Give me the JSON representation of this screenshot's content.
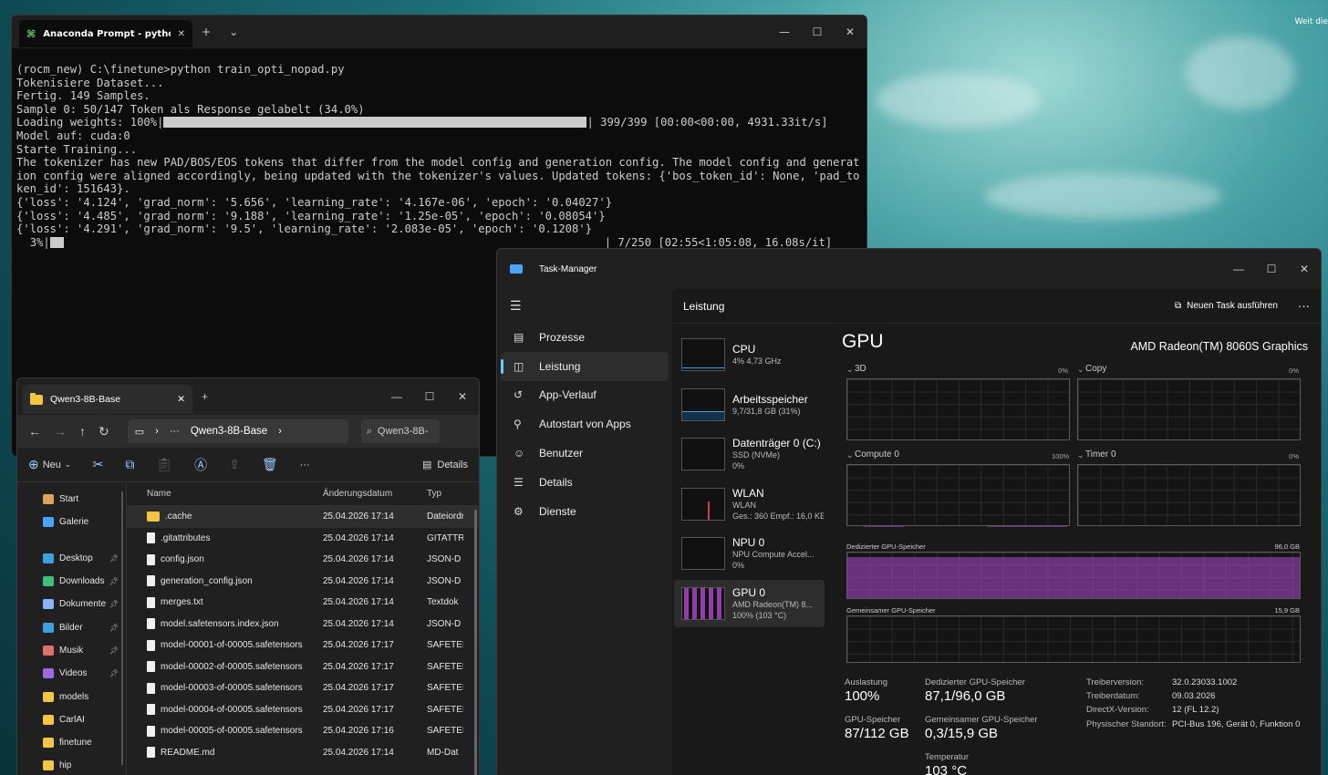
{
  "desktop": {
    "note": "Weit die"
  },
  "terminal": {
    "tab_title": "Anaconda Prompt - python t",
    "lines": {
      "l1": "(rocm_new) C:\\finetune>python train_opti_nopad.py",
      "l2": "Tokenisiere Dataset...",
      "l3": "Fertig. 149 Samples.",
      "l4": "Sample 0: 50/147 Token als Response gelabelt (34.0%)",
      "l5a": "Loading weights: 100%|",
      "l5b": "| 399/399 [00:00<00:00, 4931.33it/s]",
      "l6": "Model auf: cuda:0",
      "l7": "Starte Training...",
      "l8": "The tokenizer has new PAD/BOS/EOS tokens that differ from the model config and generation config. The model config and generation config were aligned accordingly, being updated with the tokenizer's values. Updated tokens: {'bos_token_id': None, 'pad_token_id': 151643}.",
      "l9": "{'loss': '4.124', 'grad_norm': '5.656', 'learning_rate': '4.167e-06', 'epoch': '0.04027'}",
      "l10": "{'loss': '4.485', 'grad_norm': '9.188', 'learning_rate': '1.25e-05', 'epoch': '0.08054'}",
      "l11": "{'loss': '4.291', 'grad_norm': '9.5', 'learning_rate': '2.083e-05', 'epoch': '0.1208'}",
      "l12a": "  3%|",
      "l12b": "| 7/250 [02:55<1:05:08, 16.08s/it]"
    },
    "progress": {
      "weights_fraction": 1.0,
      "training_fraction": 0.03
    }
  },
  "explorer": {
    "tab_title": "Qwen3-8B-Base",
    "path": "Qwen3-8B-Base",
    "search_placeholder": "Qwen3-8B-",
    "new_label": "Neu",
    "details_label": "Details",
    "nav": [
      {
        "label": "Start",
        "color": "#e0a05a",
        "pin": false
      },
      {
        "label": "Galerie",
        "color": "#4aa3ff",
        "pin": false
      },
      {
        "label": "Desktop",
        "color": "#3fa0e0",
        "pin": true
      },
      {
        "label": "Downloads",
        "color": "#3fc07a",
        "pin": true
      },
      {
        "label": "Dokumente",
        "color": "#8ab4f8",
        "pin": true
      },
      {
        "label": "Bilder",
        "color": "#3fa0e0",
        "pin": true
      },
      {
        "label": "Musik",
        "color": "#e0706a",
        "pin": true
      },
      {
        "label": "Videos",
        "color": "#9a6ae0",
        "pin": true
      },
      {
        "label": "models",
        "color": "#f4c542",
        "pin": false
      },
      {
        "label": "CarlAI",
        "color": "#f4c542",
        "pin": false
      },
      {
        "label": "finetune",
        "color": "#f4c542",
        "pin": false
      },
      {
        "label": "hip",
        "color": "#f4c542",
        "pin": false
      }
    ],
    "columns": {
      "name": "Name",
      "date": "Änderungsdatum",
      "type": "Typ"
    },
    "files": [
      {
        "name": ".cache",
        "date": "25.04.2026 17:14",
        "type": "Dateiordner",
        "folder": true
      },
      {
        "name": ".gitattributes",
        "date": "25.04.2026 17:14",
        "type": "GITATTR",
        "folder": false
      },
      {
        "name": "config.json",
        "date": "25.04.2026 17:14",
        "type": "JSON-D",
        "folder": false
      },
      {
        "name": "generation_config.json",
        "date": "25.04.2026 17:14",
        "type": "JSON-D",
        "folder": false
      },
      {
        "name": "merges.txt",
        "date": "25.04.2026 17:14",
        "type": "Textdok",
        "folder": false
      },
      {
        "name": "model.safetensors.index.json",
        "date": "25.04.2026 17:14",
        "type": "JSON-D",
        "folder": false
      },
      {
        "name": "model-00001-of-00005.safetensors",
        "date": "25.04.2026 17:17",
        "type": "SAFETEI",
        "folder": false
      },
      {
        "name": "model-00002-of-00005.safetensors",
        "date": "25.04.2026 17:17",
        "type": "SAFETEI",
        "folder": false
      },
      {
        "name": "model-00003-of-00005.safetensors",
        "date": "25.04.2026 17:17",
        "type": "SAFETEI",
        "folder": false
      },
      {
        "name": "model-00004-of-00005.safetensors",
        "date": "25.04.2026 17:17",
        "type": "SAFETEI",
        "folder": false
      },
      {
        "name": "model-00005-of-00005.safetensors",
        "date": "25.04.2026 17:16",
        "type": "SAFETEI",
        "folder": false
      },
      {
        "name": "README.md",
        "date": "25.04.2026 17:14",
        "type": "MD-Dat",
        "folder": false
      }
    ]
  },
  "taskmanager": {
    "title": "Task-Manager",
    "nav": [
      "Prozesse",
      "Leistung",
      "App-Verlauf",
      "Autostart von Apps",
      "Benutzer",
      "Details",
      "Dienste"
    ],
    "nav_active": 1,
    "header": "Leistung",
    "new_task": "Neuen Task ausführen",
    "devices": [
      {
        "name": "CPU",
        "sub1": "4% 4,73 GHz",
        "sub2": "",
        "sub3": ""
      },
      {
        "name": "Arbeitsspeicher",
        "sub1": "9,7/31,8 GB (31%)",
        "sub2": "",
        "sub3": ""
      },
      {
        "name": "Datenträger 0 (C:)",
        "sub1": "SSD (NVMe)",
        "sub2": "0%",
        "sub3": ""
      },
      {
        "name": "WLAN",
        "sub1": "WLAN",
        "sub2": "Ges.: 360 Empf.: 16,0 KE",
        "sub3": ""
      },
      {
        "name": "NPU 0",
        "sub1": "NPU Compute Accel...",
        "sub2": "0%",
        "sub3": ""
      },
      {
        "name": "GPU 0",
        "sub1": "AMD Radeon(TM) 8...",
        "sub2": "100% (103 °C)",
        "sub3": ""
      }
    ],
    "gpu": {
      "title": "GPU",
      "model": "AMD Radeon(TM) 8060S Graphics",
      "engines": [
        {
          "label": "3D",
          "pct": "0%"
        },
        {
          "label": "Copy",
          "pct": "0%"
        },
        {
          "label": "Compute 0",
          "pct": "100%"
        },
        {
          "label": "Timer 0",
          "pct": "0%"
        }
      ],
      "dedicated_label": "Dedizierter GPU-Speicher",
      "dedicated_max": "96,0 GB",
      "shared_label": "Gemeinsamer GPU-Speicher",
      "shared_max": "15,9 GB",
      "stats": {
        "util_label": "Auslastung",
        "util_value": "100%",
        "ded_label": "Dedizierter GPU-Speicher",
        "ded_value": "87,1/96,0 GB",
        "gpumem_label": "GPU-Speicher",
        "gpumem_value": "87/112 GB",
        "shr_label": "Gemeinsamer GPU-Speicher",
        "shr_value": "0,3/15,9 GB",
        "temp_label": "Temperatur",
        "temp_value": "103 °C"
      },
      "driver": [
        {
          "k": "Treiberversion:",
          "v": "32.0.23033.1002"
        },
        {
          "k": "Treiberdatum:",
          "v": "09.03.2026"
        },
        {
          "k": "DirectX-Version:",
          "v": "12 (FL 12.2)"
        },
        {
          "k": "Physischer Standort:",
          "v": "PCI-Bus 196, Gerät 0, Funktion 0"
        }
      ]
    },
    "colors": {
      "gpu": "#b04ad0",
      "cpu": "#3fa0e0"
    }
  }
}
